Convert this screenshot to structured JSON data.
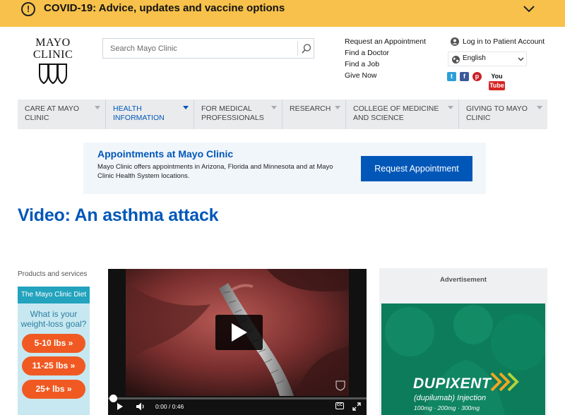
{
  "covid_banner": {
    "alert_glyph": "!",
    "text": "COVID-19: Advice, updates and vaccine options",
    "colors": {
      "background": "#f7c14b"
    }
  },
  "header": {
    "logo": {
      "line1": "MAYO",
      "line2": "CLINIC"
    },
    "search": {
      "placeholder": "Search Mayo Clinic",
      "value": ""
    },
    "utility_links": [
      "Request an Appointment",
      "Find a Doctor",
      "Find a Job",
      "Give Now"
    ],
    "login_label": "Log in to Patient Account",
    "language": {
      "selected": "English"
    },
    "social": {
      "twitter": "t",
      "facebook": "f",
      "pinterest": "p",
      "youtube_you": "You",
      "youtube_tube": "Tube"
    }
  },
  "nav": {
    "items": [
      {
        "label": "CARE AT MAYO CLINIC"
      },
      {
        "label": "HEALTH INFORMATION",
        "active": true
      },
      {
        "label": "FOR MEDICAL PROFESSIONALS"
      },
      {
        "label": "RESEARCH"
      },
      {
        "label": "COLLEGE OF MEDICINE AND SCIENCE"
      },
      {
        "label": "GIVING TO MAYO CLINIC"
      }
    ]
  },
  "appointment": {
    "title": "Appointments at Mayo Clinic",
    "description": "Mayo Clinic offers appointments in Arizona, Florida and Minnesota and at Mayo Clinic Health System locations.",
    "button_label": "Request Appointment",
    "colors": {
      "accent": "#0057b8"
    }
  },
  "page": {
    "title": "Video: An asthma attack"
  },
  "sidebar": {
    "label": "Products and services",
    "promo": {
      "header": "The Mayo Clinic Diet",
      "question_line1": "What is your",
      "question_line2": "weight-loss goal?",
      "options": [
        "5-10 lbs »",
        "11-25 lbs »",
        "25+ lbs »"
      ]
    }
  },
  "video": {
    "current_time": "0:00",
    "separator": "/",
    "duration": "0:46",
    "progress_fraction": 0,
    "cc_label": "CC"
  },
  "ad": {
    "label": "Advertisement",
    "brand": "DUPIXENT",
    "sub": "(dupilumab) Injection",
    "doses": "100mg · 200mg · 300mg"
  }
}
